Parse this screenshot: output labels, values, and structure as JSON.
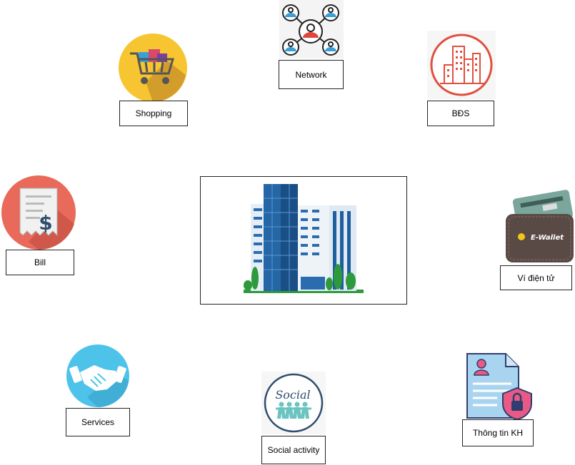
{
  "hub": {
    "icon": "office-building-icon"
  },
  "nodes": {
    "network": {
      "label": "Network",
      "icon": "people-network-icon"
    },
    "shopping": {
      "label": "Shopping",
      "icon": "shopping-cart-icon"
    },
    "bds": {
      "label": "BĐS",
      "icon": "city-buildings-icon"
    },
    "bill": {
      "label": "Bill",
      "icon": "receipt-dollar-icon"
    },
    "wallet": {
      "label": "Ví điện tử",
      "icon": "e-wallet-icon",
      "icon_text": "E-Wallet"
    },
    "services": {
      "label": "Services",
      "icon": "handshake-icon"
    },
    "social": {
      "label": "Social activity",
      "icon": "social-people-icon",
      "icon_text": "Social"
    },
    "customer": {
      "label": "Thông tin KH",
      "icon": "secure-document-icon"
    }
  },
  "colors": {
    "border": "#222222",
    "shopping_bg": "#f7c531",
    "bds_red": "#e0503f",
    "bill_bg": "#e96a5a",
    "services_bg": "#4ec3ea",
    "wallet_body": "#5a4a45",
    "building_blue": "#1f5f9e",
    "doc_blue": "#a8d4f0",
    "lock_pink": "#e85a85"
  }
}
